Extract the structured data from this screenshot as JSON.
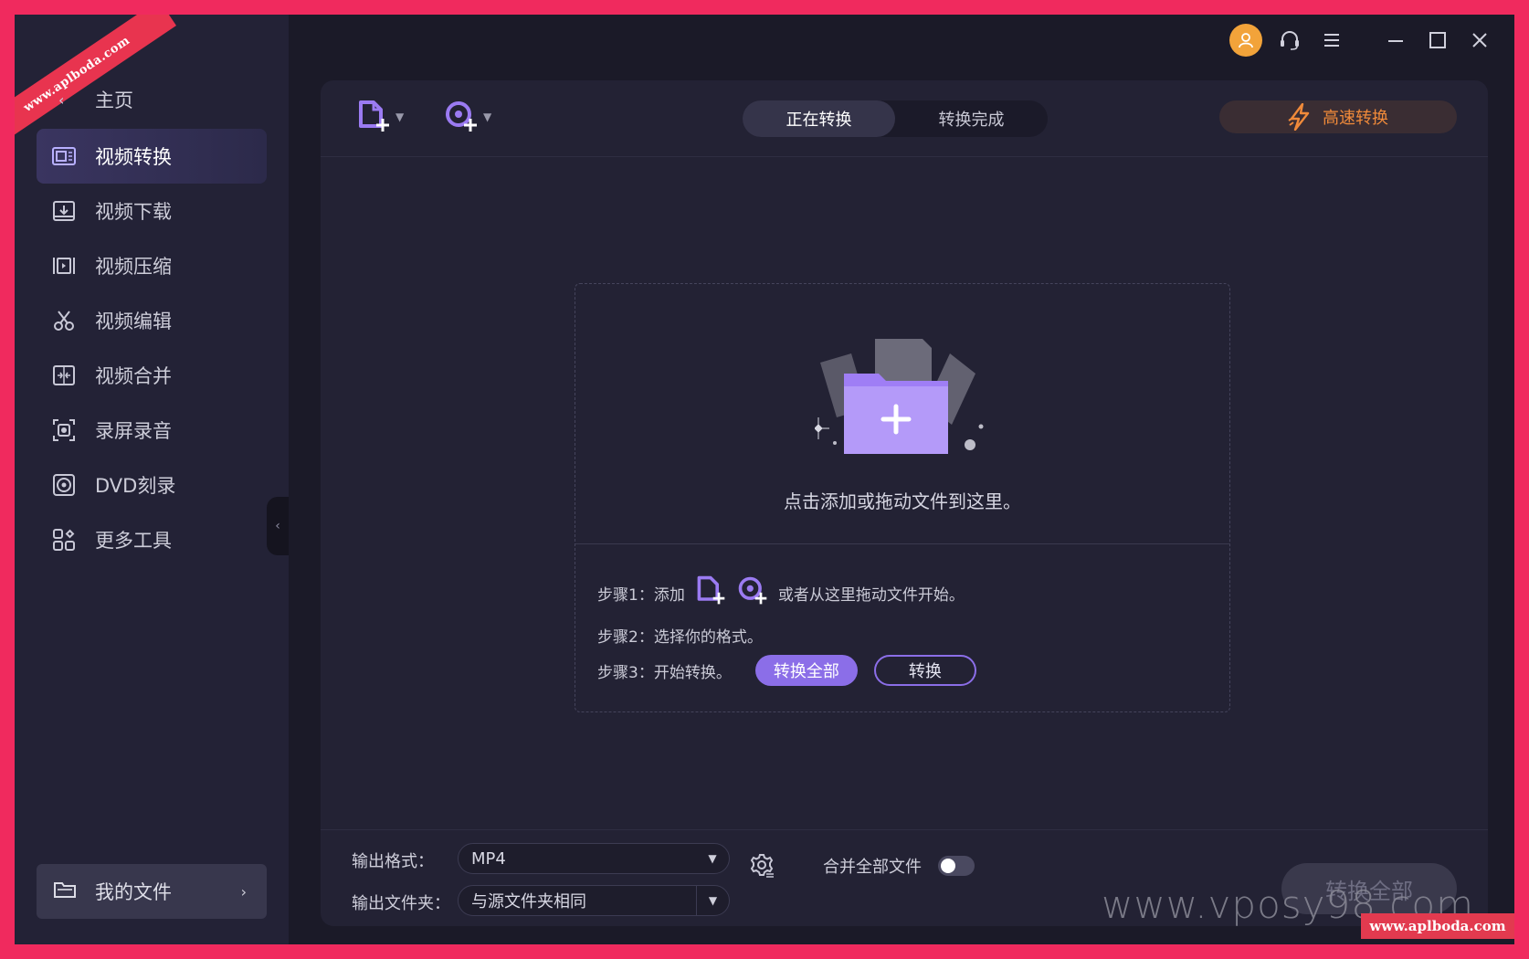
{
  "sidebar": {
    "ribbon_text": "www.aplboda.com",
    "home_label": "主页",
    "items": [
      {
        "label": "视频转换",
        "icon": "video-convert-icon"
      },
      {
        "label": "视频下载",
        "icon": "download-icon"
      },
      {
        "label": "视频压缩",
        "icon": "compress-icon"
      },
      {
        "label": "视频编辑",
        "icon": "scissors-icon"
      },
      {
        "label": "视频合并",
        "icon": "merge-icon"
      },
      {
        "label": "录屏录音",
        "icon": "screen-record-icon"
      },
      {
        "label": "DVD刻录",
        "icon": "disc-icon"
      },
      {
        "label": "更多工具",
        "icon": "grid-icon"
      }
    ],
    "my_files_label": "我的文件"
  },
  "toolbar": {
    "tabs": [
      {
        "label": "正在转换"
      },
      {
        "label": "转换完成"
      }
    ],
    "turbo_label": "高速转换"
  },
  "dropzone": {
    "hint": "点击添加或拖动文件到这里。",
    "step1_prefix": "步骤1：添加",
    "step1_suffix": "或者从这里拖动文件开始。",
    "step2": "步骤2：选择你的格式。",
    "step3": "步骤3：开始转换。",
    "convert_all_label": "转换全部",
    "convert_label": "转换"
  },
  "bottom": {
    "output_format_label": "输出格式：",
    "output_format_value": "MP4",
    "output_folder_label": "输出文件夹：",
    "output_folder_value": "与源文件夹相同",
    "merge_label": "合并全部文件",
    "convert_all_big_label": "转换全部"
  },
  "watermarks": {
    "site1": "www.vposy98.com",
    "site2": "www.aplboda.com"
  },
  "colors": {
    "accent": "#8b6ee8",
    "turbo": "#f08a3a",
    "frame": "#f02a5e"
  }
}
